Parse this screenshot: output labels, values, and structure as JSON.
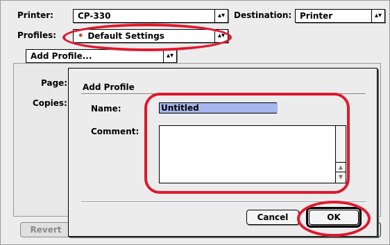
{
  "print_dialog": {
    "printer_label": "Printer:",
    "printer_value": "CP-330",
    "destination_label": "Destination:",
    "destination_value": "Printer",
    "profiles_label": "Profiles:",
    "profiles_value": "Default Settings",
    "add_profile_menu": "Add Profile...",
    "page_label": "Page:",
    "copies_label": "Copies:",
    "revert_label": "Revert"
  },
  "add_profile_sheet": {
    "title": "Add Profile",
    "name_label": "Name:",
    "name_value": "Untitled",
    "comment_label": "Comment:",
    "comment_value": "",
    "cancel_label": "Cancel",
    "ok_label": "OK"
  },
  "colors": {
    "annotation": "#e0182d",
    "selection": "#a6b6ee",
    "bullet": "#d23a1f"
  }
}
